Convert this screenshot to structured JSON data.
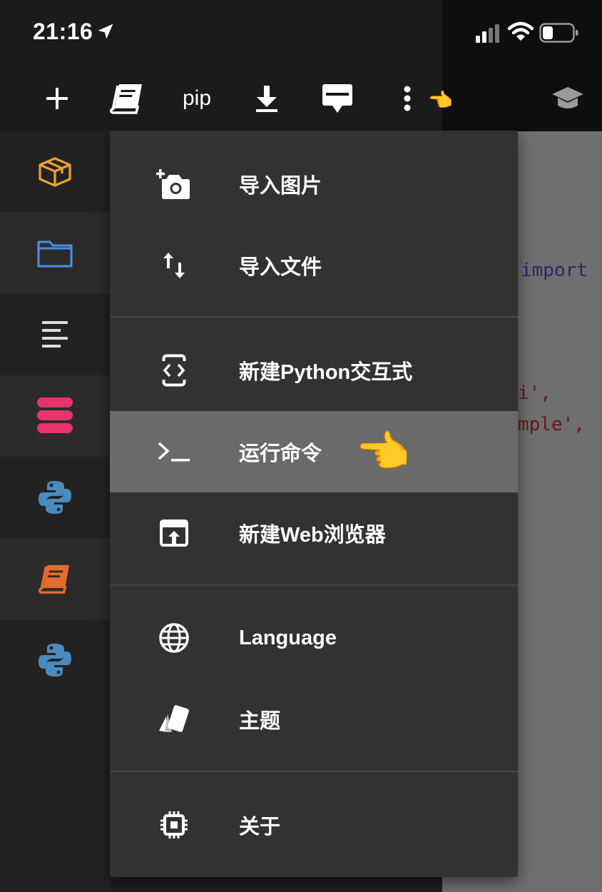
{
  "status_bar": {
    "time": "21:16"
  },
  "toolbar": {
    "pip_label": "pip"
  },
  "sidebar": {
    "items": [
      "package-icon",
      "folder-icon",
      "outline-icon",
      "database-icon",
      "python-icon",
      "notebook-icon",
      "python-icon"
    ]
  },
  "editor": {
    "line1": "import",
    "line2": "i',",
    "line3": "mple',"
  },
  "menu": {
    "items": [
      {
        "label": "导入图片",
        "icon": "add-photo-icon"
      },
      {
        "label": "导入文件",
        "icon": "import-arrows-icon"
      },
      {
        "label": "新建Python交互式",
        "icon": "interactive-code-icon"
      },
      {
        "label": "运行命令",
        "icon": "terminal-icon",
        "active": true
      },
      {
        "label": "新建Web浏览器",
        "icon": "open-browser-icon"
      },
      {
        "label": "Language",
        "icon": "globe-icon"
      },
      {
        "label": "主题",
        "icon": "theme-cards-icon"
      },
      {
        "label": "关于",
        "icon": "chip-icon"
      }
    ]
  },
  "colors": {
    "package": "#f0a030",
    "folder": "#4a90e2",
    "database": "#e8336b",
    "python_blue": "#3776ab",
    "notebook": "#e46b2c",
    "menu_bg": "#323232",
    "active_bg": "#6a6a6a"
  }
}
